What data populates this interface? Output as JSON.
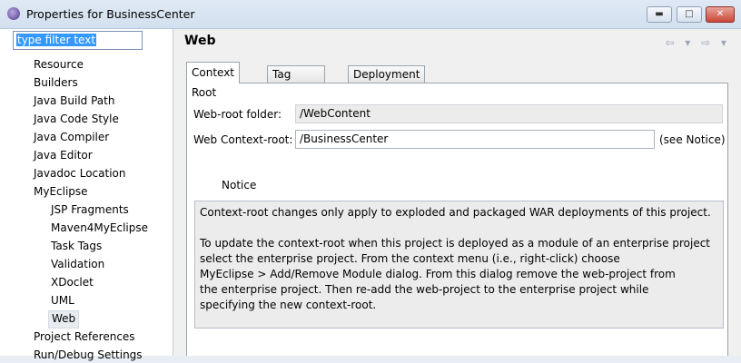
{
  "window": {
    "title": "Properties for BusinessCenter",
    "minimize": "▬",
    "maximize": "□",
    "close": "✕"
  },
  "filter": {
    "value": "type filter text"
  },
  "tree": [
    {
      "label": "Resource",
      "level": 0
    },
    {
      "label": "Builders",
      "level": 0
    },
    {
      "label": "Java Build Path",
      "level": 0
    },
    {
      "label": "Java Code Style",
      "level": 0
    },
    {
      "label": "Java Compiler",
      "level": 0
    },
    {
      "label": "Java Editor",
      "level": 0
    },
    {
      "label": "Javadoc Location",
      "level": 0
    },
    {
      "label": "MyEclipse",
      "level": 0
    },
    {
      "label": "JSP Fragments",
      "level": 1
    },
    {
      "label": "Maven4MyEclipse",
      "level": 1
    },
    {
      "label": "Task Tags",
      "level": 1
    },
    {
      "label": "Validation",
      "level": 1
    },
    {
      "label": "XDoclet",
      "level": 1
    },
    {
      "label": "UML",
      "level": 1
    },
    {
      "label": "Web",
      "level": 1,
      "selected": true
    },
    {
      "label": "Project References",
      "level": 0
    },
    {
      "label": "Run/Debug Settings",
      "level": 0
    }
  ],
  "page": {
    "title": "Web",
    "nav": "⇦ ▾ ⇨ ▾"
  },
  "tabs": [
    "Context Root",
    "Tag Libraries",
    "Deployment"
  ],
  "form": {
    "webroot_label": "Web-root folder:",
    "webroot_value": "/WebContent",
    "context_label": "Web Context-root:",
    "context_value": "/BusinessCenter",
    "see_notice": "(see Notice)"
  },
  "notice": {
    "heading": "Notice",
    "lines": [
      "Context-root changes only apply to exploded and packaged WAR deployments of this project.",
      "",
      "To update the context-root when this project is deployed as a module of an enterprise project",
      "select the enterprise project. From the context menu (i.e., right-click) choose",
      "MyEclipse > Add/Remove Module dialog. From this dialog remove the web-project from",
      "the enterprise project. Then re-add the web-project to the enterprise project while",
      "specifying the new context-root."
    ]
  }
}
